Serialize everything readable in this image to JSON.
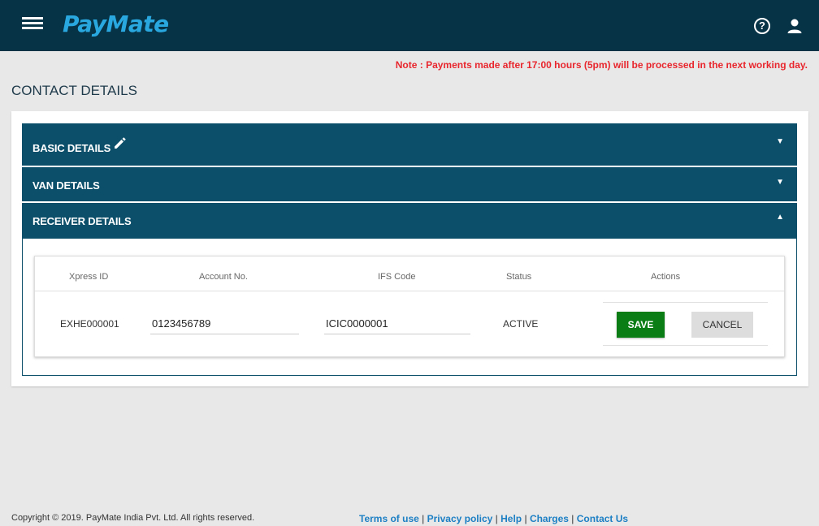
{
  "header": {
    "logo": "PayMate",
    "menu_icon": "hamburger-menu-icon",
    "help_icon": "help-circle-icon",
    "help_glyph": "?",
    "user_icon": "user-account-icon",
    "background_color": "#073347",
    "logo_color": "#29a8e0"
  },
  "note": "Note : Payments made after 17:00 hours (5pm) will be processed in the next working day.",
  "page_title": "CONTACT DETAILS",
  "accordion": {
    "basic": {
      "label": "BASIC DETAILS",
      "arrow": "▼",
      "edit_icon": "pencil-edit-icon"
    },
    "van": {
      "label": "VAN DETAILS",
      "arrow": "▼"
    },
    "receiver": {
      "label": "RECEIVER DETAILS",
      "arrow": "▲"
    },
    "header_color": "#0b4f6a"
  },
  "receiver_table": {
    "columns": [
      "Xpress ID",
      "Account No.",
      "IFS Code",
      "Status",
      "Actions"
    ],
    "row": {
      "xpress_id": "EXHE000001",
      "account_no": "0123456789",
      "ifs_code": "ICIC0000001",
      "status": "ACTIVE"
    },
    "save_label": "SAVE",
    "cancel_label": "CANCEL",
    "save_color": "#0a7d14"
  },
  "footer": {
    "copyright": "Copyright © 2019. PayMate India Pvt. Ltd. All rights reserved.",
    "separator": " | ",
    "links": [
      "Terms of use",
      "Privacy policy",
      "Help",
      "Charges",
      "Contact Us"
    ],
    "link_color": "#1c7fc4"
  },
  "note_color": "#e8262d"
}
